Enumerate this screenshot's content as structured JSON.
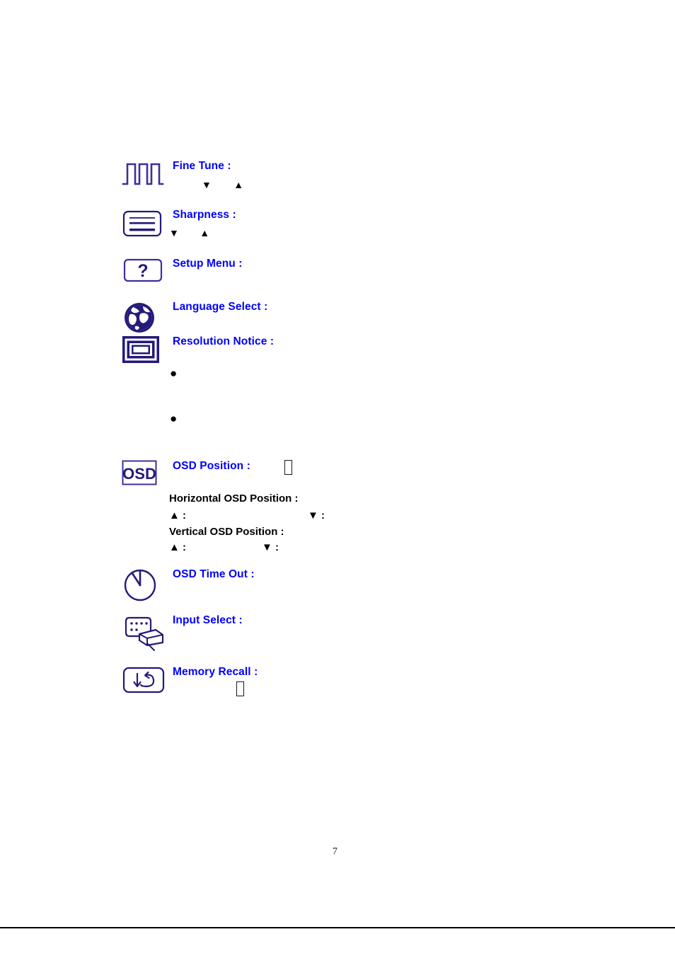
{
  "document": {
    "page_number": "7",
    "heading_color": "#0000ff",
    "icon_color": "#231a7a",
    "text_color": "#000000"
  },
  "entries": [
    {
      "id": "fine-tune",
      "icon": "square-wave-icon",
      "label": "Fine Tune :",
      "controls": {
        "down": "▼",
        "up": "▲"
      }
    },
    {
      "id": "sharpness",
      "icon": "sharpness-lines-icon",
      "label": "Sharpness :",
      "controls": {
        "down": "▼",
        "up": "▲"
      }
    },
    {
      "id": "setup-menu",
      "icon": "question-mark-icon",
      "label": "Setup Menu :"
    },
    {
      "id": "language-select",
      "icon": "globe-icon",
      "label": "Language Select :"
    },
    {
      "id": "resolution-notice",
      "icon": "monitor-frame-icon",
      "label": "Resolution Notice :",
      "bullets": [
        "●",
        "●"
      ]
    },
    {
      "id": "osd-position",
      "icon": "osd-badge-icon",
      "label": "OSD Position :",
      "missing_glyph": "",
      "sub_entries": [
        {
          "id": "horizontal-osd-position",
          "label": "Horizontal OSD Position :",
          "up": "▲ :",
          "down": "▼ :"
        },
        {
          "id": "vertical-osd-position",
          "label": "Vertical OSD Position :",
          "up": "▲ :",
          "down": "▼ :"
        }
      ]
    },
    {
      "id": "osd-time-out",
      "icon": "clock-icon",
      "label": "OSD Time Out :"
    },
    {
      "id": "input-select",
      "icon": "connector-plug-icon",
      "label": "Input Select :"
    },
    {
      "id": "memory-recall",
      "icon": "recall-arrow-icon",
      "label": "Memory Recall :",
      "missing_glyph": ""
    }
  ]
}
